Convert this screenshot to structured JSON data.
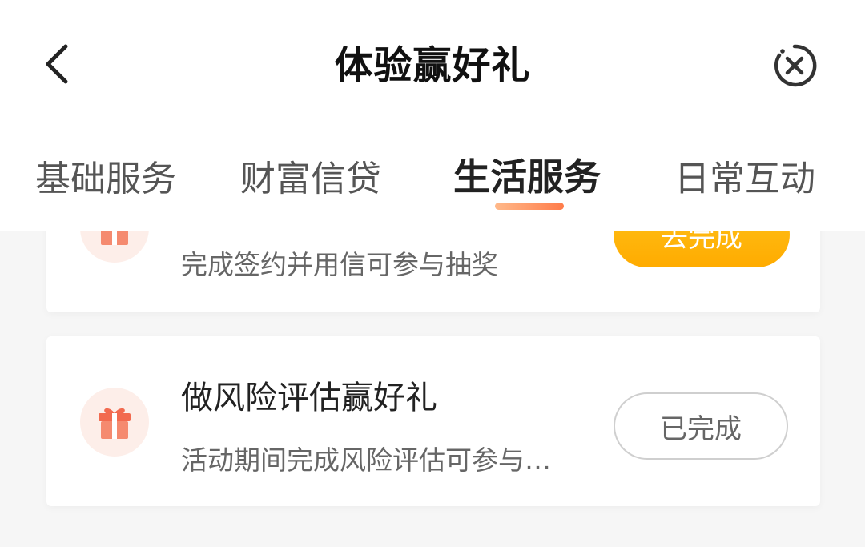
{
  "header": {
    "title": "体验赢好礼",
    "back_icon": "chevron-left-icon",
    "close_icon": "close-circle-icon"
  },
  "tabs": [
    {
      "label": "基础服务",
      "active": false
    },
    {
      "label": "财富信贷",
      "active": false
    },
    {
      "label": "生活服务",
      "active": true
    },
    {
      "label": "日常互动",
      "active": false
    }
  ],
  "tasks": [
    {
      "title": "",
      "description": "完成签约并用信可参与抽奖",
      "button_label": "去完成",
      "status": "pending",
      "icon": "gift-icon"
    },
    {
      "title": "做风险评估赢好礼",
      "description": "活动期间完成风险评估可参与…",
      "button_label": "已完成",
      "status": "done",
      "icon": "gift-icon"
    }
  ],
  "colors": {
    "accent_orange": "#ffab00",
    "tab_indicator": "#ff7c4a",
    "gift_bg": "#fdeee9",
    "gift_red": "#f26a4f"
  }
}
